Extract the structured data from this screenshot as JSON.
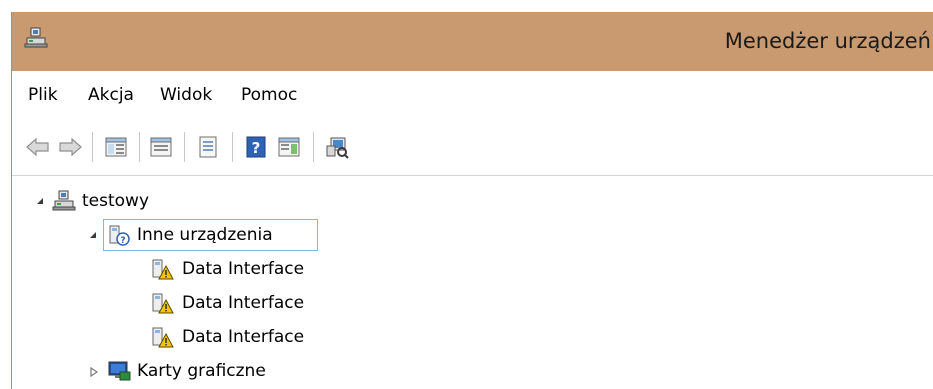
{
  "window": {
    "title": "Menedżer urządzeń",
    "titlebar_color": "#c99a70"
  },
  "menu": {
    "items": [
      {
        "label": "Plik"
      },
      {
        "label": "Akcja"
      },
      {
        "label": "Widok"
      },
      {
        "label": "Pomoc"
      }
    ]
  },
  "toolbar": {
    "buttons": [
      {
        "icon": "back-arrow-icon"
      },
      {
        "icon": "forward-arrow-icon"
      },
      {
        "icon": "show-hide-console-tree-icon"
      },
      {
        "icon": "up-one-level-icon"
      },
      {
        "icon": "properties-icon"
      },
      {
        "icon": "help-icon"
      },
      {
        "icon": "show-action-pane-icon"
      },
      {
        "icon": "scan-hardware-changes-icon"
      }
    ]
  },
  "tree": {
    "root": {
      "label": "testowy",
      "icon": "computer-icon",
      "expanded": true
    },
    "nodes": [
      {
        "label": "Inne urządzenia",
        "icon": "unknown-device-icon",
        "expanded": true,
        "selected": true
      },
      {
        "label": "Data Interface",
        "icon": "warning-device-icon"
      },
      {
        "label": "Data Interface",
        "icon": "warning-device-icon"
      },
      {
        "label": "Data Interface",
        "icon": "warning-device-icon"
      },
      {
        "label": "Karty graficzne",
        "icon": "display-adapter-icon",
        "expanded": false
      }
    ]
  },
  "colors": {
    "selection_border": "#79b8e8",
    "warning_yellow": "#f5c400"
  }
}
